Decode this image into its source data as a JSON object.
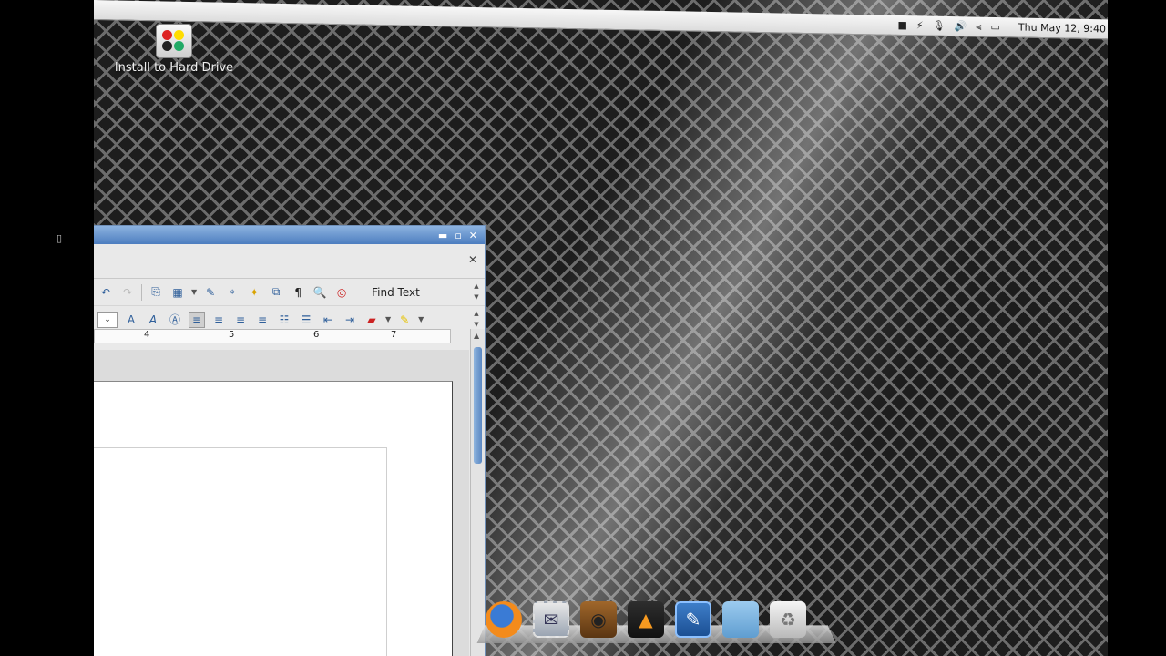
{
  "desktop": {
    "icon_label": "Install to Hard Drive"
  },
  "top_panel": {
    "tray_icons": [
      "stop-icon",
      "power-icon",
      "microphone-icon",
      "volume-icon",
      "network-icon",
      "battery-icon"
    ],
    "clock": "Thu May 12, 9:40"
  },
  "writer_window": {
    "title_buttons": {
      "minimize": "▬",
      "maximize": "▫",
      "close": "✕"
    },
    "doc_close": "✕",
    "toolbar1": {
      "find_text_label": "Find Text"
    },
    "ruler_labels": [
      "4",
      "5",
      "6",
      "7"
    ]
  },
  "dock": {
    "items": [
      "firefox",
      "thunderbird-mail",
      "audio-player",
      "vlc",
      "writer",
      "files",
      "trash"
    ]
  },
  "colors": {
    "title_bar_blue": "#4c7dbf",
    "accent": "#8db3e0"
  }
}
